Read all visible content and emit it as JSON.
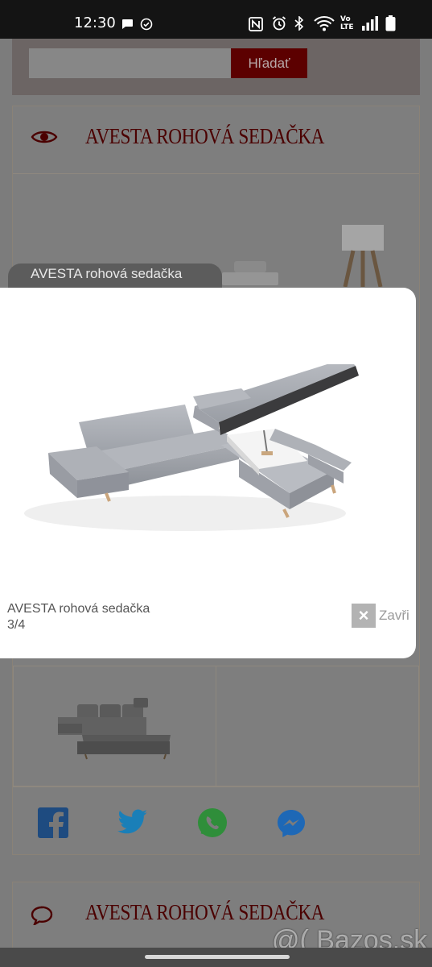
{
  "status_bar": {
    "time": "12:30",
    "icons": [
      "chat-bubble-icon",
      "check-circle-icon",
      "nfc-icon",
      "alarm-icon",
      "bluetooth-icon",
      "wifi-icon",
      "volte-icon",
      "signal-icon",
      "battery-icon"
    ],
    "volte_label": "Vo\nLTE"
  },
  "search": {
    "placeholder": "",
    "button_label": "Hľadať"
  },
  "product": {
    "title": "AVESTA ROHOVÁ SEDAČKA",
    "eye_icon": "eye-icon"
  },
  "tooltip": {
    "text": "AVESTA rohová sedačka"
  },
  "lightbox": {
    "caption": "AVESTA rohová sedačka",
    "counter": "3/4",
    "close_label": "Zavři",
    "close_icon": "close-icon"
  },
  "share": {
    "icons": [
      "facebook-icon",
      "twitter-icon",
      "whatsapp-icon",
      "messenger-icon"
    ],
    "colors": {
      "facebook": "#1e4b80",
      "twitter": "#1a7fb8",
      "whatsapp": "#2f8e3a",
      "messenger": "#1e68b6"
    }
  },
  "comments": {
    "title": "AVESTA ROHOVÁ SEDAČKA",
    "icon": "chat-bubble-outline-icon"
  },
  "watermark": "@( Bazos.sk",
  "colors": {
    "accent": "#5c0000",
    "title": "#4b0000"
  }
}
